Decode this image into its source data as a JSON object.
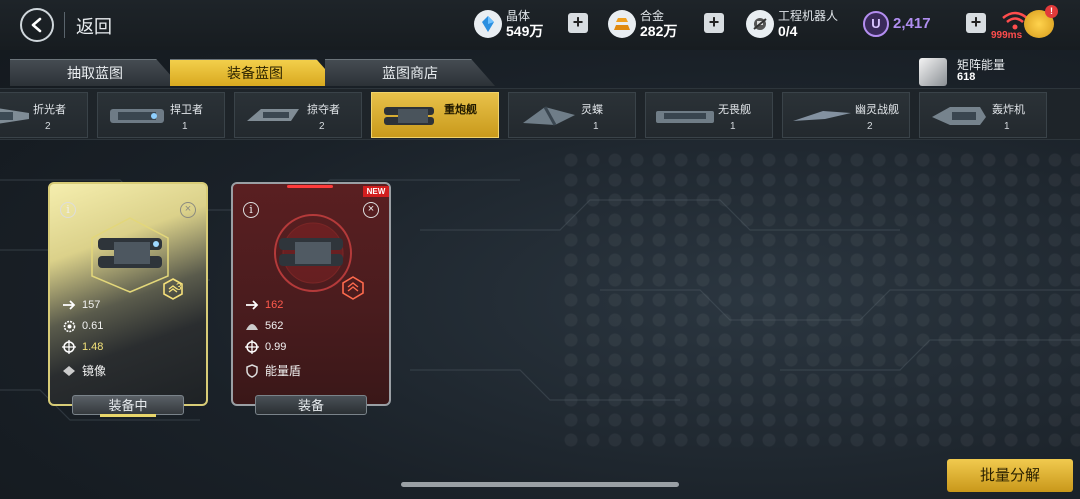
{
  "header": {
    "back_label": "返回",
    "resources": [
      {
        "name": "晶体",
        "value": "549万",
        "icon": "crystal-icon"
      },
      {
        "name": "合金",
        "value": "282万",
        "icon": "alloy-icon"
      },
      {
        "name": "工程机器人",
        "value": "0/4",
        "icon": "robot-icon"
      }
    ],
    "premium_currency": "2,417",
    "premium_symbol": "U",
    "ping": "999ms",
    "shop_badge": "!"
  },
  "tabs": [
    {
      "label": "抽取蓝图",
      "active": false
    },
    {
      "label": "装备蓝图",
      "active": true
    },
    {
      "label": "蓝图商店",
      "active": false
    }
  ],
  "matrix_energy": {
    "name": "矩阵能量",
    "value": "618"
  },
  "ships": [
    {
      "name": "折光者",
      "count": "2"
    },
    {
      "name": "捍卫者",
      "count": "1"
    },
    {
      "name": "掠夺者",
      "count": "2"
    },
    {
      "name": "重炮舰",
      "count": "",
      "active": true
    },
    {
      "name": "灵蝶",
      "count": "1"
    },
    {
      "name": "无畏舰",
      "count": "1"
    },
    {
      "name": "幽灵战舰",
      "count": "2"
    },
    {
      "name": "轰炸机",
      "count": "1"
    }
  ],
  "cards": [
    {
      "stats": [
        "157",
        "0.61",
        "1.48"
      ],
      "ability": "镜像",
      "button": "装备中"
    },
    {
      "stats": [
        "162",
        "562",
        "0.99"
      ],
      "ability": "能量盾",
      "button": "装备",
      "new_label": "NEW"
    }
  ],
  "bulk_button": "批量分解",
  "colors": {
    "accent": "#e2b42f",
    "highlight_red": "#ff4d4d",
    "premium": "#b08ef0"
  }
}
